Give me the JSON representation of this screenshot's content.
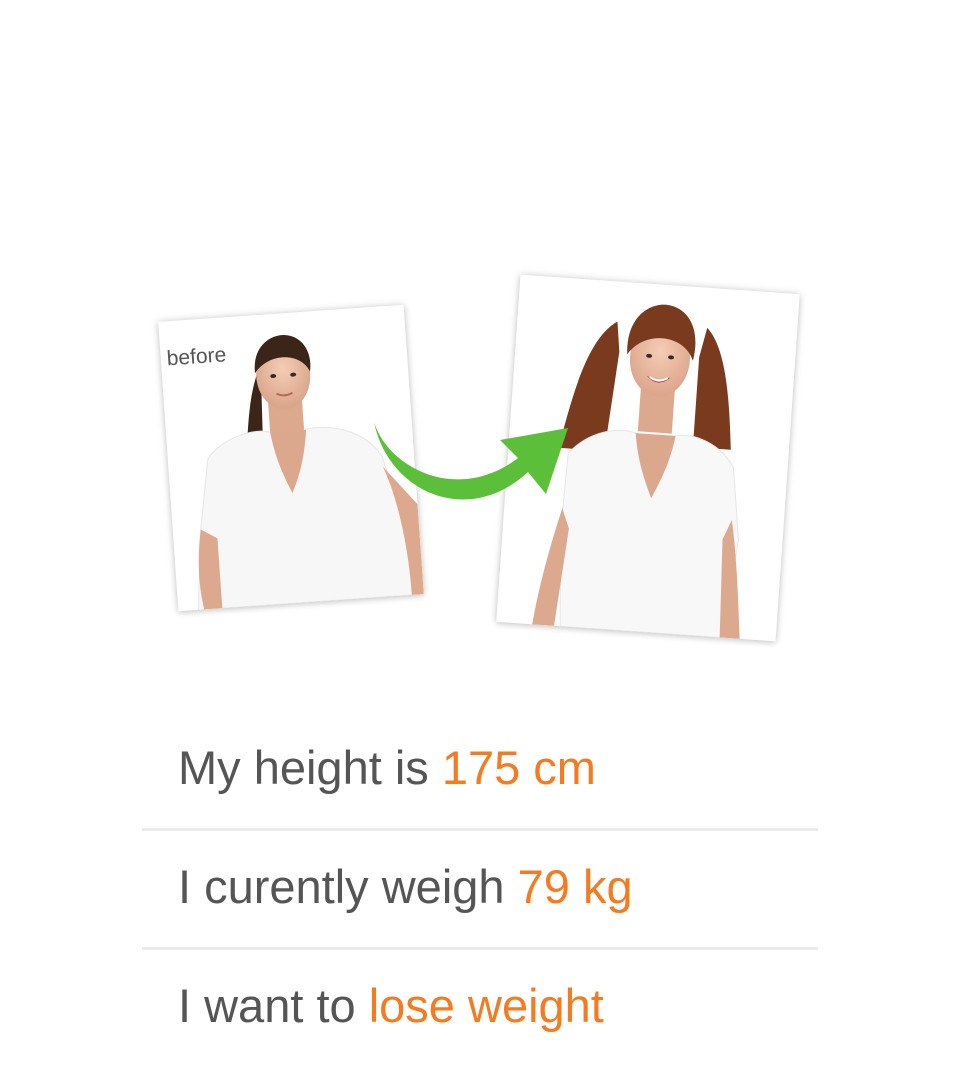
{
  "photos": {
    "before_label": "before"
  },
  "stats": [
    {
      "prefix": "My height is ",
      "value": "175 cm"
    },
    {
      "prefix": "I curently weigh ",
      "value": "79 kg"
    },
    {
      "prefix": "I want to ",
      "value": "lose weight"
    }
  ],
  "colors": {
    "text": "#555555",
    "accent": "#f47b20",
    "arrow": "#5cbf3a",
    "divider": "#eaeaea"
  },
  "icons": {
    "transformation_arrow": "curved-arrow-right-icon"
  }
}
